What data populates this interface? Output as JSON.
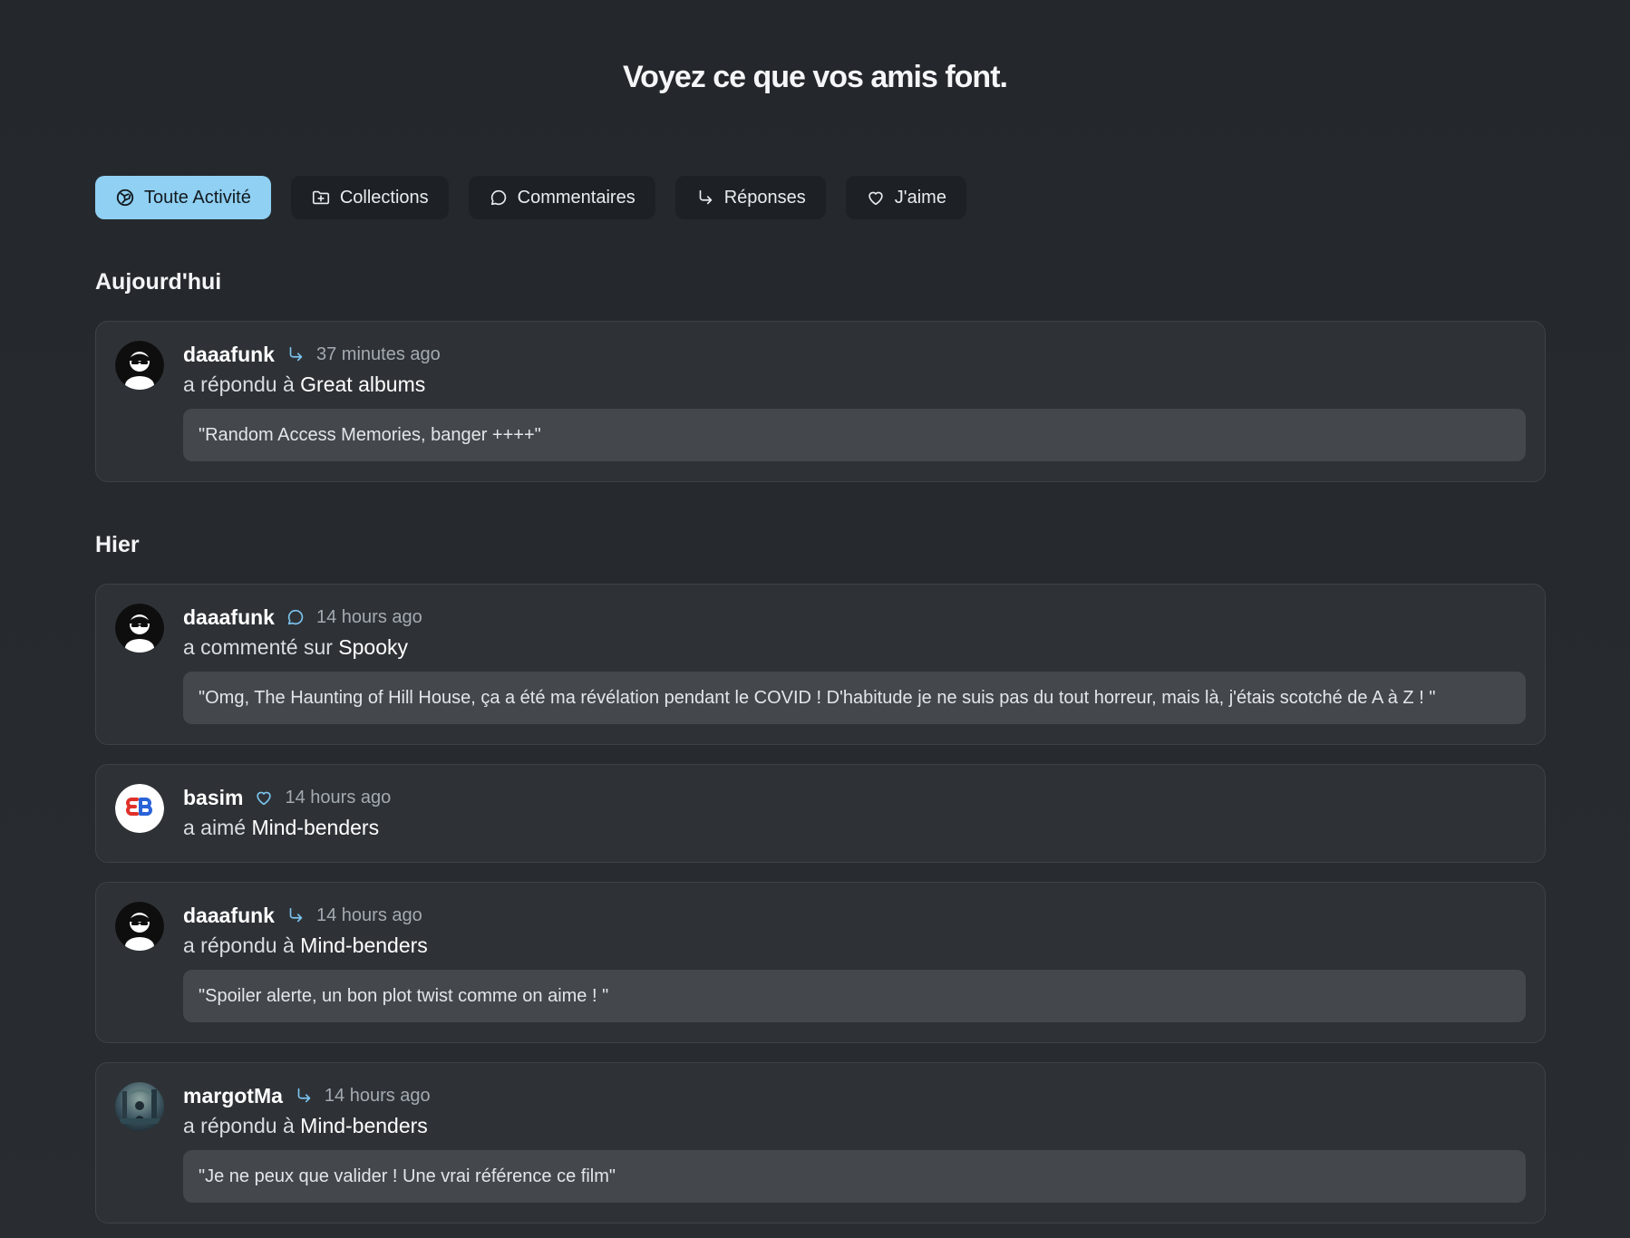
{
  "page": {
    "title": "Voyez ce que vos amis font."
  },
  "tabs": [
    {
      "label": "Toute Activité",
      "icon": "activity-icon",
      "active": true
    },
    {
      "label": "Collections",
      "icon": "folder-plus-icon",
      "active": false
    },
    {
      "label": "Commentaires",
      "icon": "comment-icon",
      "active": false
    },
    {
      "label": "Réponses",
      "icon": "reply-arrow-icon",
      "active": false
    },
    {
      "label": "J'aime",
      "icon": "heart-icon",
      "active": false
    }
  ],
  "sections": [
    {
      "title": "Aujourd'hui",
      "items": [
        {
          "username": "daaafunk",
          "avatar": "daaafunk-avatar",
          "type_icon": "reply-arrow-icon",
          "time": "37 minutes ago",
          "action": "a répondu à",
          "target": "Great albums",
          "quote": "\"Random Access Memories, banger ++++\""
        }
      ]
    },
    {
      "title": "Hier",
      "items": [
        {
          "username": "daaafunk",
          "avatar": "daaafunk-avatar",
          "type_icon": "comment-icon",
          "time": "14 hours ago",
          "action": "a commenté sur",
          "target": "Spooky",
          "quote": "\"Omg, The Haunting of Hill House, ça a été ma révélation pendant le COVID ! D'habitude je ne suis pas du tout horreur, mais là, j'étais scotché de A à Z ! \""
        },
        {
          "username": "basim",
          "avatar": "basim-avatar",
          "type_icon": "heart-icon",
          "time": "14 hours ago",
          "action": "a aimé",
          "target": "Mind-benders",
          "quote": ""
        },
        {
          "username": "daaafunk",
          "avatar": "daaafunk-avatar",
          "type_icon": "reply-arrow-icon",
          "time": "14 hours ago",
          "action": "a répondu à",
          "target": "Mind-benders",
          "quote": "\"Spoiler alerte, un bon plot twist comme on aime ! \""
        },
        {
          "username": "margotMa",
          "avatar": "margotma-avatar",
          "type_icon": "reply-arrow-icon",
          "time": "14 hours ago",
          "action": "a répondu à",
          "target": "Mind-benders",
          "quote": "\"Je ne peux que valider ! Une vrai référence ce film\""
        }
      ]
    }
  ],
  "colors": {
    "accent": "#8fd0f3",
    "background": "#262a2e",
    "card": "#2e3236",
    "quote_bg": "#44484d",
    "icon_blue": "#7cc4ee"
  }
}
